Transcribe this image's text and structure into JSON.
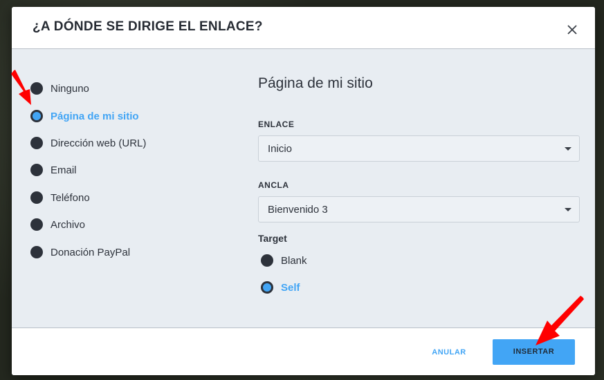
{
  "dialog": {
    "title": "¿A DÓNDE SE DIRIGE EL ENLACE?"
  },
  "link_types": [
    {
      "label": "Ninguno",
      "checked": false
    },
    {
      "label": "Página de mi sitio",
      "checked": true
    },
    {
      "label": "Dirección web (URL)",
      "checked": false
    },
    {
      "label": "Email",
      "checked": false
    },
    {
      "label": "Teléfono",
      "checked": false
    },
    {
      "label": "Archivo",
      "checked": false
    },
    {
      "label": "Donación PayPal",
      "checked": false
    }
  ],
  "panel": {
    "title": "Página de mi sitio",
    "link_field": {
      "label": "ENLACE",
      "value": "Inicio"
    },
    "anchor_field": {
      "label": "ANCLA",
      "value": "Bienvenido 3"
    },
    "target": {
      "label": "Target",
      "options": [
        {
          "label": "Blank",
          "checked": false
        },
        {
          "label": "Self",
          "checked": true
        }
      ]
    }
  },
  "footer": {
    "cancel_label": "ANULAR",
    "insert_label": "INSERTAR"
  },
  "colors": {
    "accent": "#42a5f5",
    "dark": "#2d323b",
    "annotation_arrow": "#ff0000"
  },
  "icons": {
    "close": "close-icon",
    "dropdown": "caret-down-icon"
  }
}
